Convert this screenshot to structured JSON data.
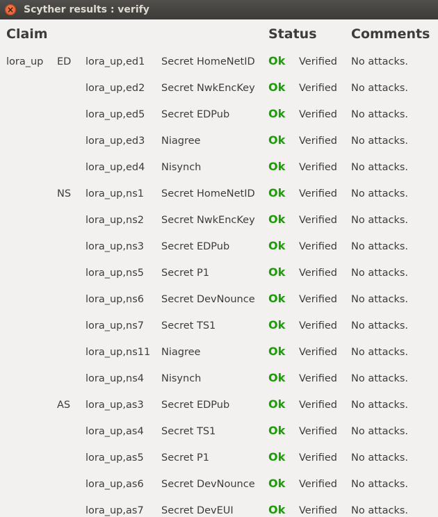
{
  "window": {
    "title": "Scyther results : verify"
  },
  "headers": {
    "claim": "Claim",
    "status": "Status",
    "comments": "Comments"
  },
  "rows": [
    {
      "protocol": "lora_up",
      "role": "ED",
      "id": "lora_up,ed1",
      "claim": "Secret HomeNetID",
      "status": "Ok",
      "result": "Verified",
      "comment": "No attacks."
    },
    {
      "protocol": "",
      "role": "",
      "id": "lora_up,ed2",
      "claim": "Secret NwkEncKey",
      "status": "Ok",
      "result": "Verified",
      "comment": "No attacks."
    },
    {
      "protocol": "",
      "role": "",
      "id": "lora_up,ed5",
      "claim": "Secret EDPub",
      "status": "Ok",
      "result": "Verified",
      "comment": "No attacks."
    },
    {
      "protocol": "",
      "role": "",
      "id": "lora_up,ed3",
      "claim": "Niagree",
      "status": "Ok",
      "result": "Verified",
      "comment": "No attacks."
    },
    {
      "protocol": "",
      "role": "",
      "id": "lora_up,ed4",
      "claim": "Nisynch",
      "status": "Ok",
      "result": "Verified",
      "comment": "No attacks."
    },
    {
      "protocol": "",
      "role": "NS",
      "id": "lora_up,ns1",
      "claim": "Secret HomeNetID",
      "status": "Ok",
      "result": "Verified",
      "comment": "No attacks."
    },
    {
      "protocol": "",
      "role": "",
      "id": "lora_up,ns2",
      "claim": "Secret NwkEncKey",
      "status": "Ok",
      "result": "Verified",
      "comment": "No attacks."
    },
    {
      "protocol": "",
      "role": "",
      "id": "lora_up,ns3",
      "claim": "Secret EDPub",
      "status": "Ok",
      "result": "Verified",
      "comment": "No attacks."
    },
    {
      "protocol": "",
      "role": "",
      "id": "lora_up,ns5",
      "claim": "Secret P1",
      "status": "Ok",
      "result": "Verified",
      "comment": "No attacks."
    },
    {
      "protocol": "",
      "role": "",
      "id": "lora_up,ns6",
      "claim": "Secret DevNounce",
      "status": "Ok",
      "result": "Verified",
      "comment": "No attacks."
    },
    {
      "protocol": "",
      "role": "",
      "id": "lora_up,ns7",
      "claim": "Secret TS1",
      "status": "Ok",
      "result": "Verified",
      "comment": "No attacks."
    },
    {
      "protocol": "",
      "role": "",
      "id": "lora_up,ns11",
      "claim": "Niagree",
      "status": "Ok",
      "result": "Verified",
      "comment": "No attacks."
    },
    {
      "protocol": "",
      "role": "",
      "id": "lora_up,ns4",
      "claim": "Nisynch",
      "status": "Ok",
      "result": "Verified",
      "comment": "No attacks."
    },
    {
      "protocol": "",
      "role": "AS",
      "id": "lora_up,as3",
      "claim": "Secret EDPub",
      "status": "Ok",
      "result": "Verified",
      "comment": "No attacks."
    },
    {
      "protocol": "",
      "role": "",
      "id": "lora_up,as4",
      "claim": "Secret TS1",
      "status": "Ok",
      "result": "Verified",
      "comment": "No attacks."
    },
    {
      "protocol": "",
      "role": "",
      "id": "lora_up,as5",
      "claim": "Secret P1",
      "status": "Ok",
      "result": "Verified",
      "comment": "No attacks."
    },
    {
      "protocol": "",
      "role": "",
      "id": "lora_up,as6",
      "claim": "Secret DevNounce",
      "status": "Ok",
      "result": "Verified",
      "comment": "No attacks."
    },
    {
      "protocol": "",
      "role": "",
      "id": "lora_up,as7",
      "claim": "Secret DevEUI",
      "status": "Ok",
      "result": "Verified",
      "comment": "No attacks."
    }
  ],
  "colors": {
    "ok_green": "#17a000",
    "titlebar": "#3c3b37",
    "background": "#f2f1f0",
    "close_button": "#e05a25"
  }
}
